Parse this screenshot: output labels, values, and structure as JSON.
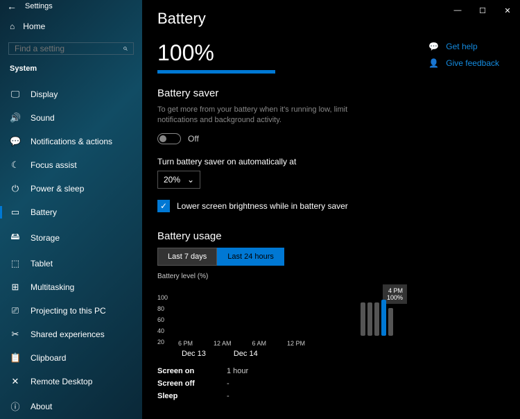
{
  "window": {
    "title": "Settings"
  },
  "sidebar": {
    "home": "Home",
    "search_placeholder": "Find a setting",
    "section": "System",
    "items": [
      {
        "icon": "🖵",
        "label": "Display"
      },
      {
        "icon": "🔊",
        "label": "Sound"
      },
      {
        "icon": "💬",
        "label": "Notifications & actions"
      },
      {
        "icon": "☾",
        "label": "Focus assist"
      },
      {
        "icon": "⏻",
        "label": "Power & sleep"
      },
      {
        "icon": "▭",
        "label": "Battery"
      },
      {
        "icon": "🖴",
        "label": "Storage"
      },
      {
        "icon": "⬚",
        "label": "Tablet"
      },
      {
        "icon": "⊞",
        "label": "Multitasking"
      },
      {
        "icon": "⎚",
        "label": "Projecting to this PC"
      },
      {
        "icon": "✂",
        "label": "Shared experiences"
      },
      {
        "icon": "📋",
        "label": "Clipboard"
      },
      {
        "icon": "✕",
        "label": "Remote Desktop"
      },
      {
        "icon": "ⓘ",
        "label": "About"
      }
    ]
  },
  "page": {
    "title": "Battery",
    "percent": "100%",
    "help": "Get help",
    "feedback": "Give feedback",
    "saver": {
      "heading": "Battery saver",
      "desc": "To get more from your battery when it's running low, limit notifications and background activity.",
      "toggle_state": "Off",
      "auto_label": "Turn battery saver on automatically at",
      "auto_value": "20%",
      "checkbox_label": "Lower screen brightness while in battery saver"
    },
    "usage": {
      "heading": "Battery usage",
      "tab1": "Last 7 days",
      "tab2": "Last 24 hours",
      "ylabel": "Battery level (%)",
      "tooltip_time": "4 PM",
      "tooltip_val": "100%",
      "date1": "Dec 13",
      "date2": "Dec 14",
      "stats": {
        "screen_on_k": "Screen on",
        "screen_on_v": "1 hour",
        "screen_off_k": "Screen off",
        "screen_off_v": "-",
        "sleep_k": "Sleep",
        "sleep_v": "-"
      }
    }
  },
  "chart_data": {
    "type": "bar",
    "title": "Battery level (%)",
    "ylabel": "Battery level (%)",
    "ylim": [
      0,
      100
    ],
    "y_ticks": [
      100,
      80,
      60,
      40,
      20
    ],
    "x_ticks": [
      "6 PM",
      "12 AM",
      "6 AM",
      "12 PM"
    ],
    "x_dates": [
      "Dec 13",
      "Dec 14"
    ],
    "highlight": {
      "time": "4 PM",
      "value": 100
    }
  }
}
